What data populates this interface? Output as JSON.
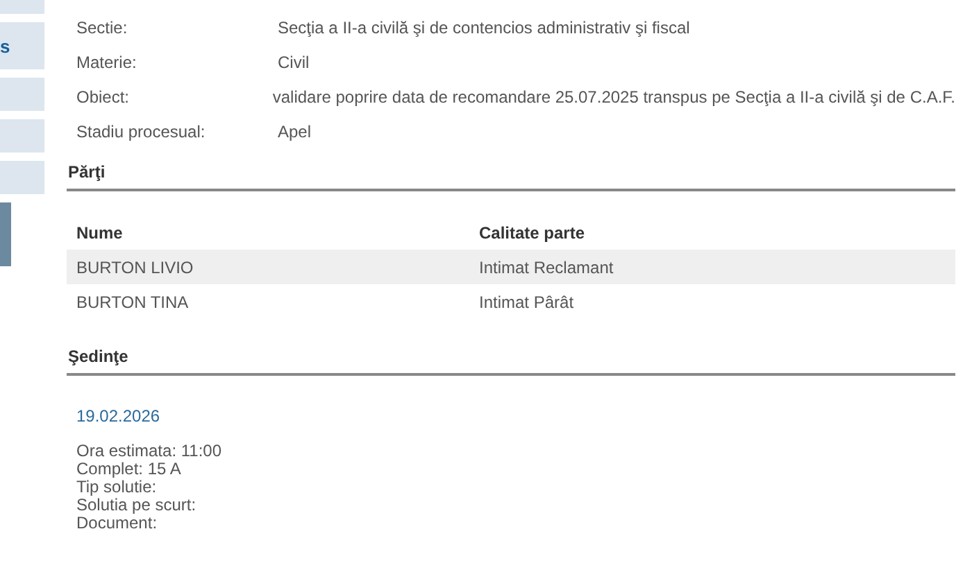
{
  "sidebar": {
    "item_label": "s"
  },
  "details": [
    {
      "label": "Sectie:",
      "value": "Secţia a II-a civilă şi de contencios administrativ şi fiscal"
    },
    {
      "label": "Materie:",
      "value": "Civil"
    },
    {
      "label": "Obiect:",
      "value": "validare poprire data de recomandare 25.07.2025 transpus pe Secţia a II-a civilă şi de C.A.F."
    },
    {
      "label": "Stadiu procesual:",
      "value": "Apel"
    }
  ],
  "parti": {
    "title": "Părţi",
    "columns": [
      "Nume",
      "Calitate parte"
    ],
    "rows": [
      {
        "cells": [
          "BURTON LIVIO",
          "Intimat Reclamant"
        ]
      },
      {
        "cells": [
          "BURTON TINA",
          "Intimat Pârât"
        ]
      }
    ]
  },
  "sedinte": {
    "title": "Şedinţe",
    "date": "19.02.2026",
    "lines": [
      "Ora estimata: 11:00",
      "Complet: 15 A",
      "Tip solutie:",
      "Solutia pe scurt:",
      "Document:"
    ]
  }
}
